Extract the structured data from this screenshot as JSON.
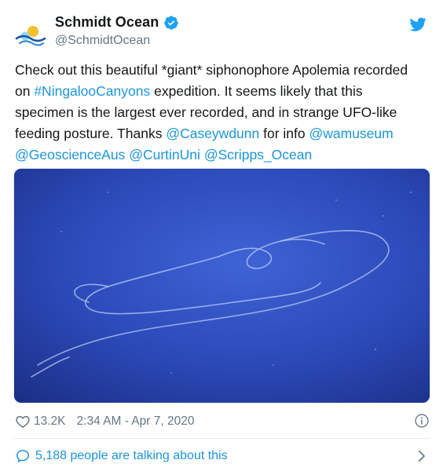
{
  "account": {
    "display_name": "Schmidt Ocean",
    "handle": "@SchmidtOcean",
    "verified_icon": "verified-badge-icon",
    "brand_color": "#1da1f2"
  },
  "tweet": {
    "line_1": "Check out this beautiful *giant* siphonophore Apolemia recorded",
    "line_2_pre": "on ",
    "hashtag": "#NingalooCanyons",
    "line_2_post": " expedition. It seems likely that this",
    "line_3": "specimen is the largest ever recorded, and in strange UFO-like",
    "line_4_pre": "feeding posture. Thanks ",
    "mention_1": "@Caseywdunn",
    "line_4_mid": " for info ",
    "mention_2": "@wamuseum",
    "mention_3": "@GeoscienceAus",
    "mention_4": "@CurtinUni",
    "mention_5": "@Scripps_Ocean"
  },
  "media": {
    "icon": "ocean-photo",
    "water_color": "#2f4fc4"
  },
  "footer": {
    "likes": "13.2K",
    "timestamp": "2:34 AM - Apr 7, 2020",
    "talking": "5,188 people are talking about this",
    "link_color": "#1b95e0"
  }
}
